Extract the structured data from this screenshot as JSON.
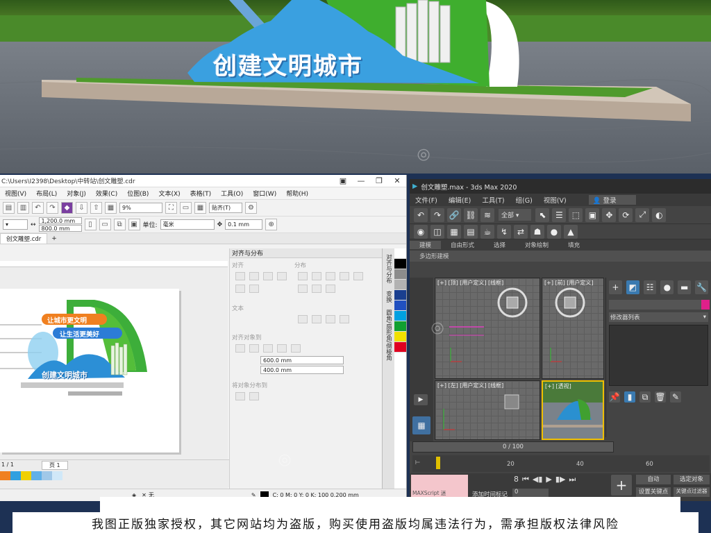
{
  "render": {
    "slogan": "创建文明城市"
  },
  "coreldraw": {
    "title": "C:\\Users\\I2398\\Desktop\\中转站\\创文雕塑.cdr",
    "menu": [
      "视图(V)",
      "布局(L)",
      "对象(J)",
      "效果(C)",
      "位图(B)",
      "文本(X)",
      "表格(T)",
      "工具(O)",
      "窗口(W)",
      "帮助(H)"
    ],
    "zoom_value": "9%",
    "snap_label": "贴齐(T)",
    "width_value": "1,200.0 mm",
    "height_value": "800.0 mm",
    "unit_label": "单位:",
    "unit_value": "毫米",
    "nudge_value": "0.1 mm",
    "doc_tab": "创文雕塑.cdr",
    "artwork": {
      "line1": "让城市更文明",
      "line2": "让生活更美好",
      "slogan": "创建文明城市"
    },
    "panel": {
      "title": "对齐与分布",
      "sec_align": "对齐",
      "sec_distribute": "分布",
      "sec_text": "文本",
      "sec_align_to": "对齐对象到",
      "field_x": "600.0 mm",
      "field_y": "400.0 mm",
      "sec_distribute_to": "将对象分布到"
    },
    "vertical_tabs": [
      "对齐与分布",
      "变换",
      "圆角/扇形角/倒棱角"
    ],
    "palette": [
      "#ffffff",
      "#000000",
      "#8c8c8c",
      "#b2b2b2",
      "#1a3f8f",
      "#2050c0",
      "#00a0e0",
      "#10a030",
      "#f0e000",
      "#e00020"
    ],
    "bottom_colors": [
      "#f08020",
      "#30a0e0",
      "#f0d000",
      "#60b0e8",
      "#a0c8e8",
      "#d0e8f8"
    ],
    "page_label": "页 1",
    "page_nav": "1 / 1",
    "status_fill": "无",
    "status_color": "C: 0 M: 0 Y: 0 K: 100  0.200 mm"
  },
  "max": {
    "title": "创文雕塑.max - 3ds Max 2020",
    "menu": [
      "文件(F)",
      "编辑(E)",
      "工具(T)",
      "组(G)",
      "视图(V)"
    ],
    "login": "登录",
    "selection_filter": "全部",
    "ribbon": [
      "建模",
      "自由形式",
      "选择",
      "对象绘制",
      "填充"
    ],
    "subribbon": "多边形建模",
    "viewports": {
      "top": "[+] [顶] [用户定义] [线框]",
      "front": "[+] [前] [用户定义]",
      "left": "[+] [左] [用户定义] [线框]",
      "persp": "[+] [透视]"
    },
    "modifier_list": "修改器列表",
    "timeline": "0 / 100",
    "track_ticks": [
      "20",
      "40",
      "60"
    ],
    "maxscript": "MAXScript 迷",
    "auto_key": "自动",
    "set_key": "设置关键点",
    "selected": "选定对象",
    "key_filters": "关键点过滤器",
    "add_time_tag": "添加时间标记",
    "frame": "0"
  },
  "notice": "我图正版独家授权，其它网站均为盗版，购买使用盗版均属违法行为，需承担版权法律风险"
}
